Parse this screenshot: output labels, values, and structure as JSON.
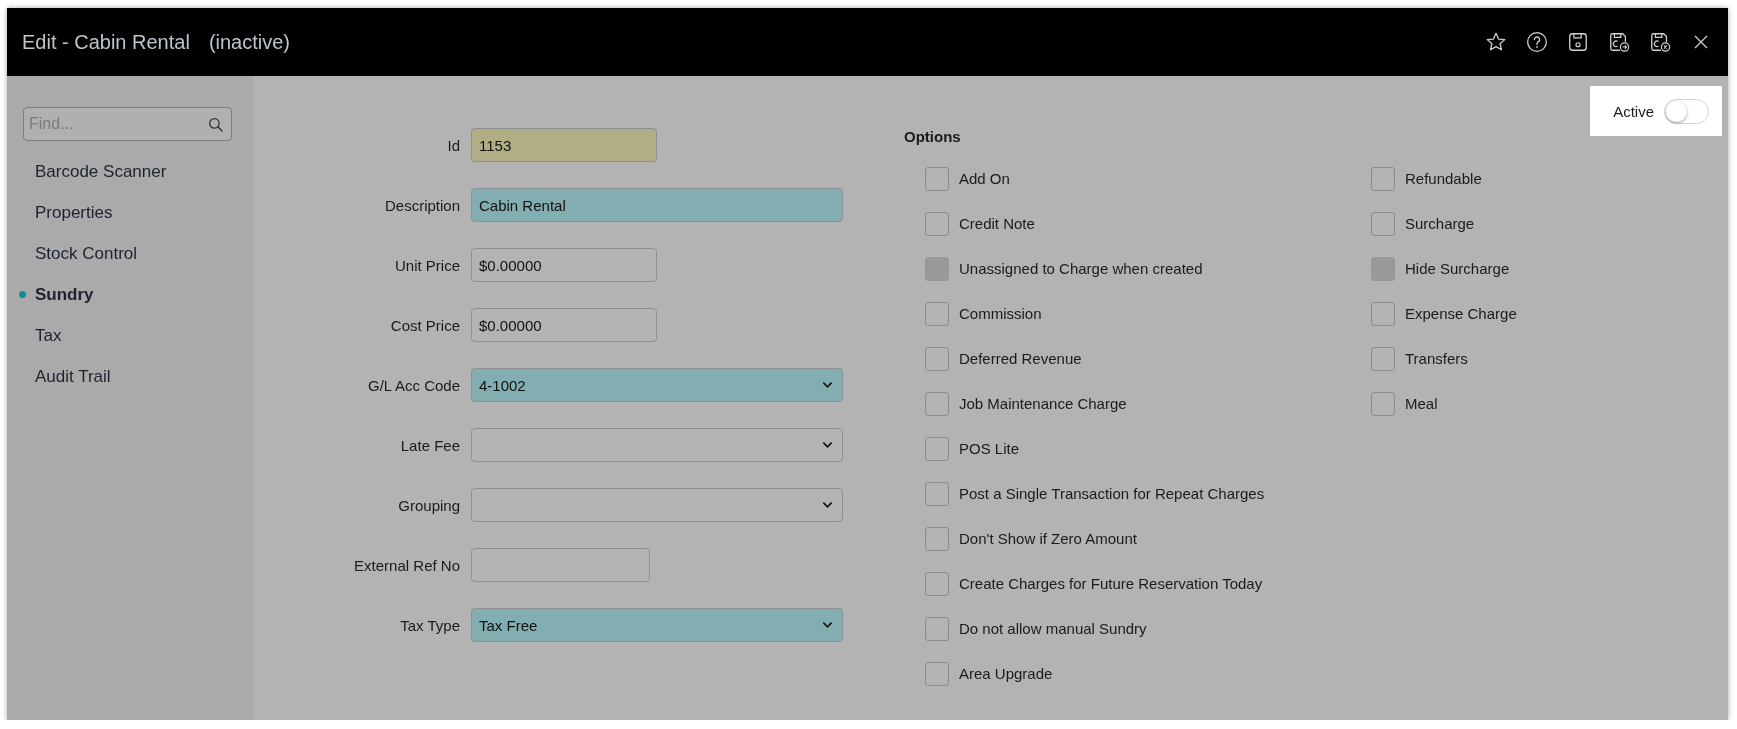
{
  "window": {
    "title": "Edit - Cabin Rental",
    "status": "(inactive)"
  },
  "sidebar": {
    "search": {
      "placeholder": "Find..."
    },
    "items": [
      {
        "label": "Barcode Scanner",
        "selected": false
      },
      {
        "label": "Properties",
        "selected": false
      },
      {
        "label": "Stock Control",
        "selected": false
      },
      {
        "label": "Sundry",
        "selected": true
      },
      {
        "label": "Tax",
        "selected": false
      },
      {
        "label": "Audit Trail",
        "selected": false
      }
    ]
  },
  "form": {
    "fields": [
      {
        "label": "Id",
        "kind": "text",
        "value": "1153",
        "readonly": true,
        "required": false
      },
      {
        "label": "Description",
        "kind": "text",
        "value": "Cabin Rental",
        "readonly": false,
        "required": true
      },
      {
        "label": "Unit Price",
        "kind": "text",
        "value": "$0.00000",
        "readonly": false,
        "required": false
      },
      {
        "label": "Cost Price",
        "kind": "text",
        "value": "$0.00000",
        "readonly": false,
        "required": false
      },
      {
        "label": "G/L Acc Code",
        "kind": "select",
        "value": "4-1002",
        "readonly": false,
        "required": true
      },
      {
        "label": "Late Fee",
        "kind": "select",
        "readonly": false,
        "required": false
      },
      {
        "label": "Grouping",
        "kind": "select",
        "readonly": false,
        "required": false
      },
      {
        "label": "External Ref No",
        "kind": "text",
        "readonly": false,
        "required": false
      },
      {
        "label": "Tax Type",
        "kind": "select",
        "value": "Tax Free",
        "readonly": false,
        "required": true
      }
    ]
  },
  "options": {
    "title": "Options",
    "columns": [
      {
        "items": [
          {
            "label": "Add On",
            "checked": false,
            "disabled": false
          },
          {
            "label": "Credit Note",
            "checked": false,
            "disabled": false
          },
          {
            "label": "Unassigned to Charge when created",
            "checked": false,
            "disabled": true
          },
          {
            "label": "Commission",
            "checked": false,
            "disabled": false
          },
          {
            "label": "Deferred Revenue",
            "checked": false,
            "disabled": false
          },
          {
            "label": "Job Maintenance Charge",
            "checked": false,
            "disabled": false
          },
          {
            "label": "POS Lite",
            "checked": false,
            "disabled": false
          },
          {
            "label": "Post a Single Transaction for Repeat Charges",
            "checked": false,
            "disabled": false
          },
          {
            "label": "Don't Show if Zero Amount",
            "checked": false,
            "disabled": false
          },
          {
            "label": "Create Charges for Future Reservation Today",
            "checked": false,
            "disabled": false
          },
          {
            "label": "Do not allow manual Sundry",
            "checked": false,
            "disabled": false
          },
          {
            "label": "Area Upgrade",
            "checked": false,
            "disabled": false
          }
        ]
      },
      {
        "items": [
          {
            "label": "Refundable",
            "checked": false,
            "disabled": false
          },
          {
            "label": "Surcharge",
            "checked": false,
            "disabled": false
          },
          {
            "label": "Hide Surcharge",
            "checked": false,
            "disabled": true
          },
          {
            "label": "Expense Charge",
            "checked": false,
            "disabled": false
          },
          {
            "label": "Transfers",
            "checked": false,
            "disabled": false
          },
          {
            "label": "Meal",
            "checked": false,
            "disabled": false
          }
        ]
      }
    ]
  },
  "active_toggle": {
    "label": "Active",
    "on": false
  }
}
